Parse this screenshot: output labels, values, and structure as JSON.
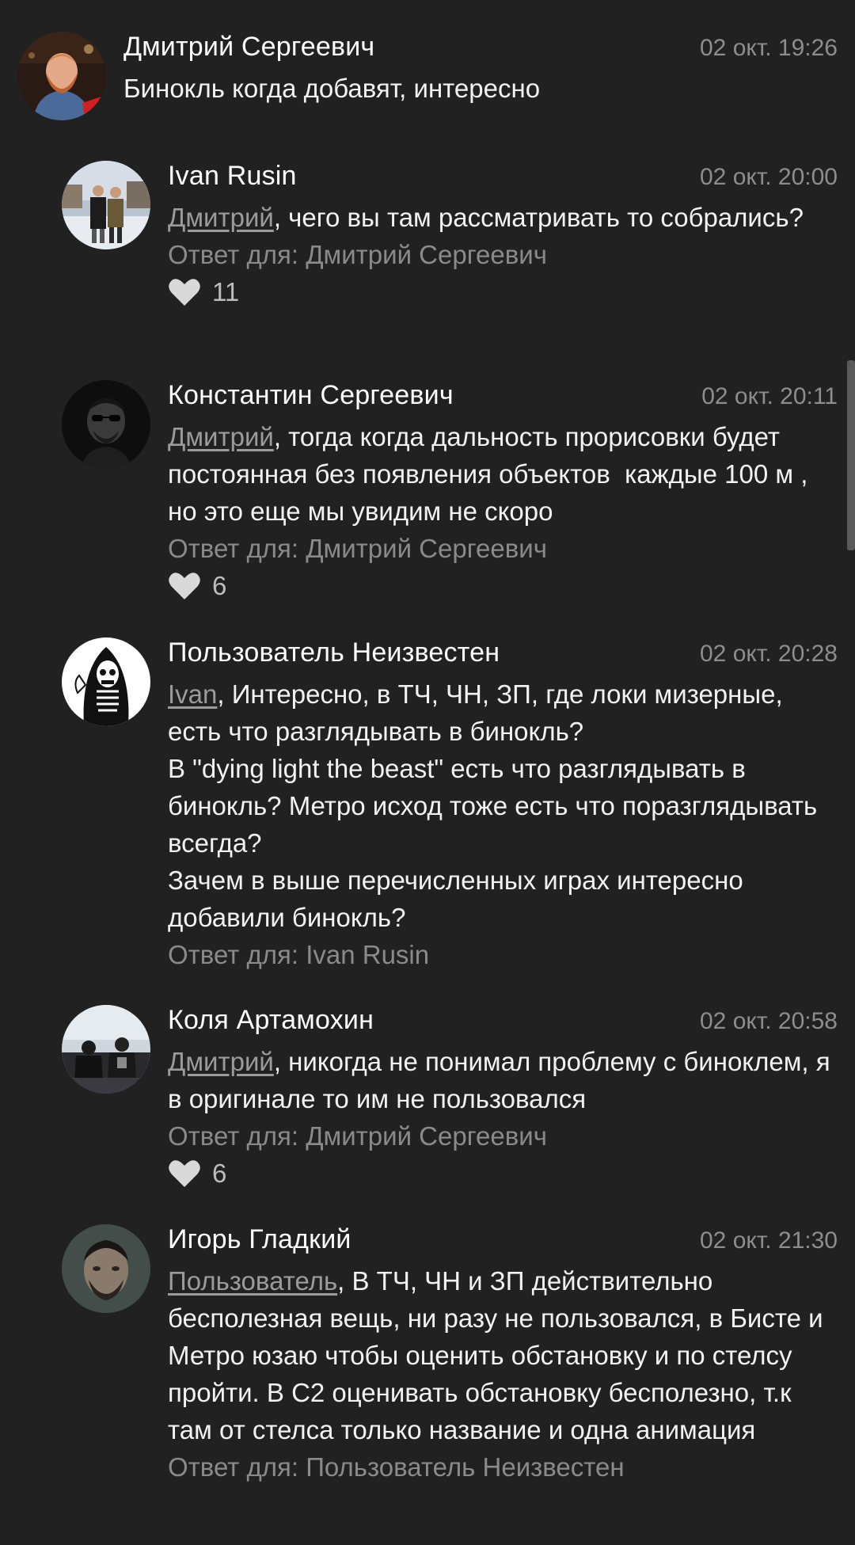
{
  "comments": [
    {
      "author": "Дмитрий Сергеевич",
      "time": "02 окт. 19:26",
      "mention": "",
      "text": "Бинокль когда добавят, интересно",
      "reply_to": "",
      "likes": ""
    },
    {
      "author": "Ivan Rusin",
      "time": "02 окт. 20:00",
      "mention": "Дмитрий",
      "text": ", чего вы там рассматривать то собрались?",
      "reply_to": "Ответ для: Дмитрий Сергеевич",
      "likes": "11"
    },
    {
      "author": "Константин Сергеевич",
      "time": "02 окт. 20:11",
      "mention": "Дмитрий",
      "text": ", тогда когда дальность прорисовки будет постоянная без появления объектов  каждые 100 м , но это еще мы увидим не скоро",
      "reply_to": "Ответ для: Дмитрий Сергеевич",
      "likes": "6"
    },
    {
      "author": "Пользователь Неизвестен",
      "time": "02 окт. 20:28",
      "mention": "Ivan",
      "text": ", Интересно, в ТЧ, ЧН, ЗП, где локи мизерные, есть что разглядывать в бинокль?\nВ \"dying light the beast\" есть что разглядывать в бинокль? Метро исход тоже есть что поразглядывать всегда?\nЗачем в выше перечисленных играх интересно добавили бинокль?",
      "reply_to": "Ответ для: Ivan Rusin",
      "likes": ""
    },
    {
      "author": "Коля Артамохин",
      "time": "02 окт. 20:58",
      "mention": "Дмитрий",
      "text": ", никогда не понимал проблему с биноклем, я в оригинале то им не пользовался",
      "reply_to": "Ответ для: Дмитрий Сергеевич",
      "likes": "6"
    },
    {
      "author": "Игорь Гладкий",
      "time": "02 окт. 21:30",
      "mention": "Пользователь",
      "text": ", В ТЧ, ЧН и ЗП действительно бесполезная вещь, ни разу не пользовался, в Бисте и Метро юзаю чтобы оценить обстановку и по стелсу пройти. В С2 оценивать обстановку бесполезно, т.к там от стелса только название и одна анимация",
      "reply_to": "Ответ для: Пользователь Неизвестен",
      "likes": ""
    }
  ],
  "icons": {
    "like": "heart-icon"
  },
  "colors": {
    "background": "#212121",
    "text": "#f2f2f2",
    "muted": "#8a8a8a"
  }
}
